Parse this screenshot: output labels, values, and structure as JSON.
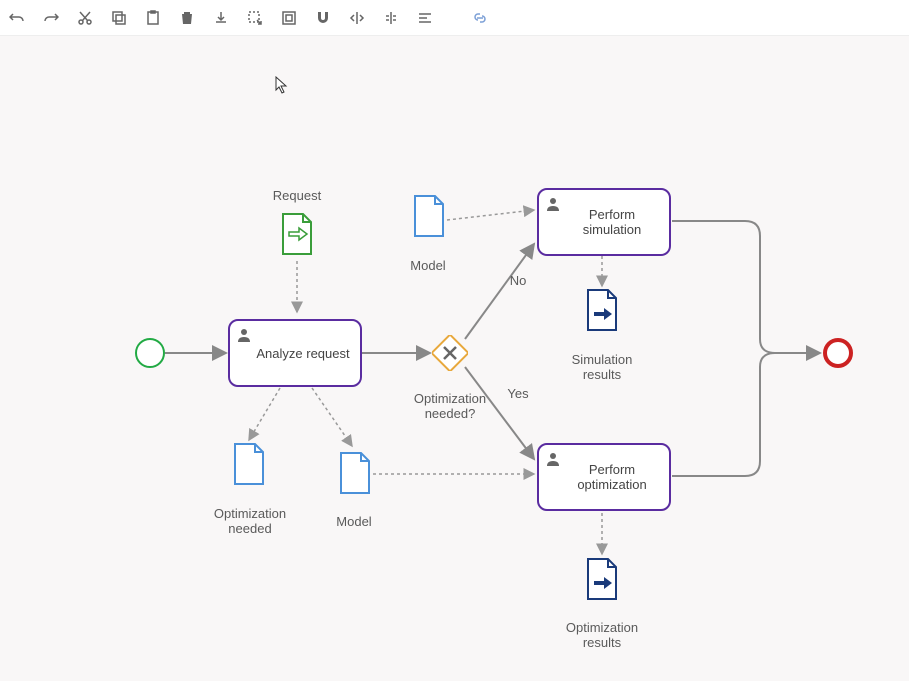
{
  "toolbar": {
    "icons": [
      "undo",
      "redo",
      "cut",
      "copy",
      "paste",
      "delete",
      "download",
      "select-box",
      "fit",
      "magnet",
      "flip-h",
      "flip-v",
      "align",
      "link"
    ]
  },
  "diagram": {
    "start_label": "",
    "tasks": {
      "analyze": "Analyze request",
      "simulation": "Perform simulation",
      "optimization": "Perform optimization"
    },
    "gateway": {
      "label": "Optimization needed?",
      "no": "No",
      "yes": "Yes"
    },
    "data_objects": {
      "request": "Request",
      "model_top": "Model",
      "model_bottom": "Model",
      "opt_needed": "Optimization needed",
      "sim_results": "Simulation results",
      "opt_results": "Optimization results"
    }
  },
  "colors": {
    "task_border": "#5a2ca0",
    "start": "#22aa44",
    "end": "#cc2222",
    "gateway": "#e8a83c",
    "doc_blue": "#4a90d9",
    "doc_dark": "#1a3a7a",
    "doc_green": "#3a9d3a",
    "connector": "#888",
    "dotted": "#999"
  }
}
